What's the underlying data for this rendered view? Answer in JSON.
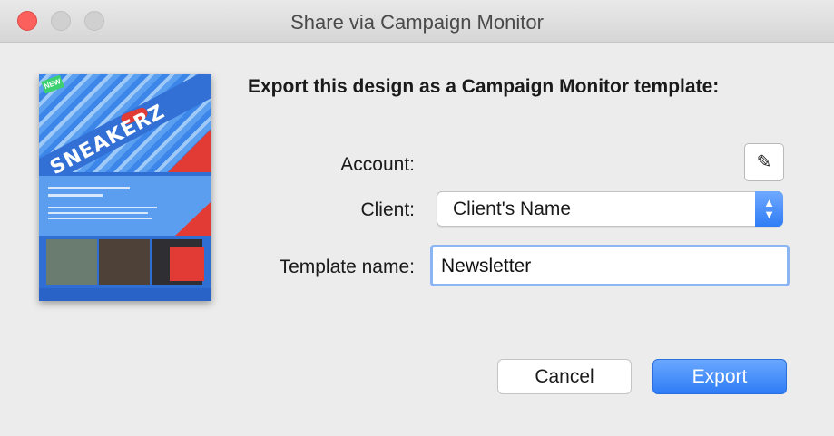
{
  "window": {
    "title": "Share via Campaign Monitor"
  },
  "thumbnail": {
    "hero_text": "SNEAKERZ",
    "badge": "NEW"
  },
  "dialog": {
    "heading": "Export this design as a Campaign Monitor template:",
    "account_label": "Account:",
    "client_label": "Client:",
    "client_value": "Client's Name",
    "template_label": "Template name:",
    "template_value": "Newsletter",
    "edit_icon": "pencil-icon"
  },
  "buttons": {
    "cancel": "Cancel",
    "export": "Export"
  },
  "colors": {
    "accent": "#2e7cf6",
    "close_light": "#fc605c",
    "thumbnail_blue": "#2f6fd4",
    "thumbnail_red": "#e23b35"
  }
}
